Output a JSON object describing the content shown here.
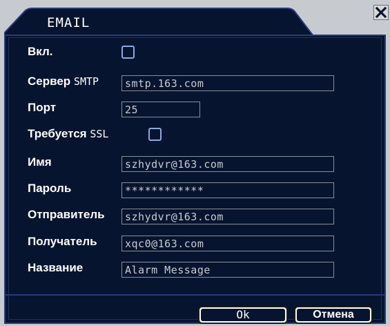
{
  "window": {
    "title": "EMAIL",
    "close_icon": "close-icon"
  },
  "form": {
    "enable": {
      "label": "Вкл.",
      "checked": false
    },
    "smtp_server": {
      "label_bold": "Сервер",
      "label_thin": "SMTP",
      "value": "smtp.163.com"
    },
    "port": {
      "label": "Порт",
      "value": "25"
    },
    "ssl": {
      "label_bold": "Требуется",
      "label_thin": "SSL",
      "checked": false
    },
    "username": {
      "label": "Имя",
      "value": "szhydvr@163.com"
    },
    "password": {
      "label": "Пароль",
      "value": "************"
    },
    "sender": {
      "label": "Отправитель",
      "value": "szhydvr@163.com"
    },
    "receiver": {
      "label": "Получатель",
      "value": "xqc0@163.com"
    },
    "subject": {
      "label": "Название",
      "value": "Alarm Message"
    }
  },
  "buttons": {
    "ok": "Ok",
    "cancel": "Отмена"
  },
  "colors": {
    "panel_bg": "#07142f",
    "panel_border": "#2a3a78",
    "frame_gray": "#c7cbcf",
    "field_border": "#8a8f99",
    "checkbox_border": "#8fa8e0",
    "text": "#ffffff",
    "field_text": "#c8cbd2"
  }
}
